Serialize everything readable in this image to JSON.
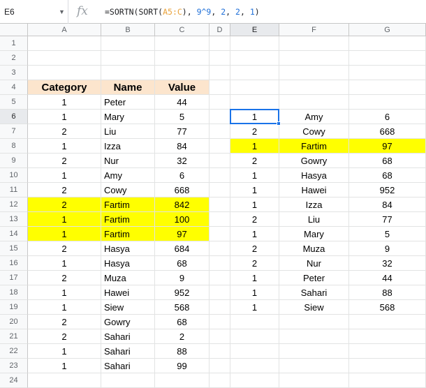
{
  "formula_bar": {
    "name_box": "E6",
    "fx": "fx",
    "formula_parts": [
      {
        "text": "=SORTN(SORT(",
        "kind": "plain"
      },
      {
        "text": "A5:C",
        "kind": "ref"
      },
      {
        "text": "), ",
        "kind": "plain"
      },
      {
        "text": "9^9",
        "kind": "num"
      },
      {
        "text": ", ",
        "kind": "plain"
      },
      {
        "text": "2",
        "kind": "num"
      },
      {
        "text": ", ",
        "kind": "plain"
      },
      {
        "text": "2",
        "kind": "num"
      },
      {
        "text": ", ",
        "kind": "plain"
      },
      {
        "text": "1",
        "kind": "num"
      },
      {
        "text": ")",
        "kind": "plain"
      }
    ]
  },
  "columns": [
    "A",
    "B",
    "C",
    "D",
    "E",
    "F",
    "G"
  ],
  "rows": [
    "1",
    "2",
    "3",
    "4",
    "5",
    "6",
    "7",
    "8",
    "9",
    "10",
    "11",
    "12",
    "13",
    "14",
    "15",
    "16",
    "17",
    "18",
    "19",
    "20",
    "21",
    "22",
    "23",
    "24"
  ],
  "selected_cell": {
    "col": "E",
    "row": "6"
  },
  "source_table": {
    "headers": [
      "Category",
      "Name",
      "Value"
    ],
    "rows": [
      [
        "1",
        "Peter",
        "44"
      ],
      [
        "1",
        "Mary",
        "5"
      ],
      [
        "2",
        "Liu",
        "77"
      ],
      [
        "1",
        "Izza",
        "84"
      ],
      [
        "2",
        "Nur",
        "32"
      ],
      [
        "1",
        "Amy",
        "6"
      ],
      [
        "2",
        "Cowy",
        "668"
      ],
      [
        "2",
        "Fartim",
        "842"
      ],
      [
        "1",
        "Fartim",
        "100"
      ],
      [
        "1",
        "Fartim",
        "97"
      ],
      [
        "2",
        "Hasya",
        "684"
      ],
      [
        "1",
        "Hasya",
        "68"
      ],
      [
        "2",
        "Muza",
        "9"
      ],
      [
        "1",
        "Hawei",
        "952"
      ],
      [
        "1",
        "Siew",
        "568"
      ],
      [
        "2",
        "Gowry",
        "68"
      ],
      [
        "2",
        "Sahari",
        "2"
      ],
      [
        "1",
        "Sahari",
        "88"
      ],
      [
        "1",
        "Sahari",
        "99"
      ]
    ],
    "highlighted_rows": [
      7,
      8,
      9
    ]
  },
  "result_table": {
    "rows": [
      [
        "1",
        "Amy",
        "6"
      ],
      [
        "2",
        "Cowy",
        "668"
      ],
      [
        "1",
        "Fartim",
        "97"
      ],
      [
        "2",
        "Gowry",
        "68"
      ],
      [
        "1",
        "Hasya",
        "68"
      ],
      [
        "1",
        "Hawei",
        "952"
      ],
      [
        "1",
        "Izza",
        "84"
      ],
      [
        "2",
        "Liu",
        "77"
      ],
      [
        "1",
        "Mary",
        "5"
      ],
      [
        "2",
        "Muza",
        "9"
      ],
      [
        "2",
        "Nur",
        "32"
      ],
      [
        "1",
        "Peter",
        "44"
      ],
      [
        "1",
        "Sahari",
        "88"
      ],
      [
        "1",
        "Siew",
        "568"
      ]
    ],
    "highlighted_rows": [
      2
    ]
  },
  "colors": {
    "highlight": "#ffff00",
    "header_fill": "#fce5cd",
    "selection": "#1a73e8"
  }
}
